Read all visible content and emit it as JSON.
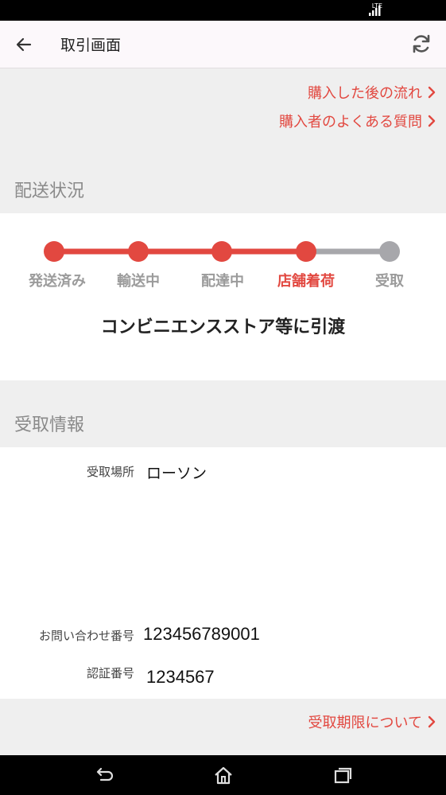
{
  "status_bar": {
    "network": "LTE"
  },
  "app_bar": {
    "title": "取引画面",
    "icons": {
      "back": "arrow-left-icon",
      "refresh": "refresh-icon"
    }
  },
  "links": {
    "after_purchase": "購入した後の流れ",
    "buyer_faq": "購入者のよくある質問",
    "pickup_deadline": "受取期限について"
  },
  "delivery_status": {
    "heading": "配送状況",
    "steps": [
      {
        "label": "発送済み",
        "done": true
      },
      {
        "label": "輸送中",
        "done": true
      },
      {
        "label": "配達中",
        "done": true
      },
      {
        "label": "店舗着荷",
        "done": true,
        "current": true
      },
      {
        "label": "受取",
        "done": false
      }
    ],
    "status_text": "コンビニエンスストア等に引渡"
  },
  "pickup_info": {
    "heading": "受取情報",
    "location_label": "受取場所",
    "location_value": "ローソン",
    "inquiry_label": "お問い合わせ番号",
    "inquiry_value": "123456789001",
    "auth_label": "認証番号",
    "auth_value": "1234567"
  },
  "colors": {
    "accent": "#e24840",
    "inactive": "#a7a7ab",
    "background": "#efefef",
    "panel": "#ffffff"
  },
  "nav_bar": {
    "icons": [
      "back-icon",
      "home-icon",
      "recents-icon"
    ]
  }
}
